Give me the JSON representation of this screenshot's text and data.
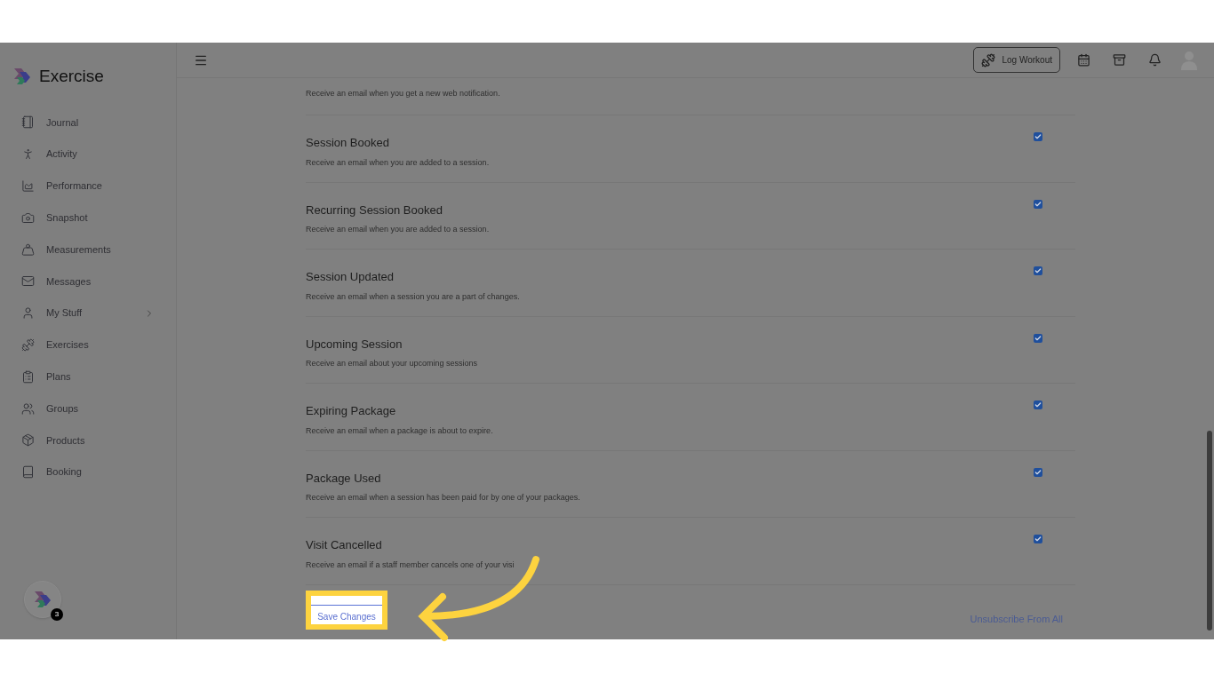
{
  "brand": {
    "name": "Exercise"
  },
  "sidebar": {
    "items": [
      {
        "label": "Journal",
        "expandable": false
      },
      {
        "label": "Activity",
        "expandable": false
      },
      {
        "label": "Performance",
        "expandable": false
      },
      {
        "label": "Snapshot",
        "expandable": false
      },
      {
        "label": "Measurements",
        "expandable": false
      },
      {
        "label": "Messages",
        "expandable": false
      },
      {
        "label": "My Stuff",
        "expandable": true
      },
      {
        "label": "Exercises",
        "expandable": false
      },
      {
        "label": "Plans",
        "expandable": false
      },
      {
        "label": "Groups",
        "expandable": false
      },
      {
        "label": "Products",
        "expandable": false
      },
      {
        "label": "Booking",
        "expandable": false
      }
    ],
    "help_badge": "3"
  },
  "header": {
    "log_workout_button": "Log Workout"
  },
  "notifications": {
    "partial_item": {
      "description": "Receive an email when you get a new web notification."
    },
    "items": [
      {
        "title": "Session Booked",
        "description": "Receive an email when you are added to a session.",
        "checked": true
      },
      {
        "title": "Recurring Session Booked",
        "description": "Receive an email when you are added to a session.",
        "checked": true
      },
      {
        "title": "Session Updated",
        "description": "Receive an email when a session you are a part of changes.",
        "checked": true
      },
      {
        "title": "Upcoming Session",
        "description": "Receive an email about your upcoming sessions",
        "checked": true
      },
      {
        "title": "Expiring Package",
        "description": "Receive an email when a package is about to expire.",
        "checked": true
      },
      {
        "title": "Package Used",
        "description": "Receive an email when a session has been paid for by one of your packages.",
        "checked": true
      },
      {
        "title": "Visit Cancelled",
        "description": "Receive an email if a staff member cancels one of your visi",
        "checked": true
      }
    ]
  },
  "footer": {
    "save_button": "Save Changes",
    "unsubscribe_link": "Unsubscribe From All",
    "save_highlighted": true
  }
}
